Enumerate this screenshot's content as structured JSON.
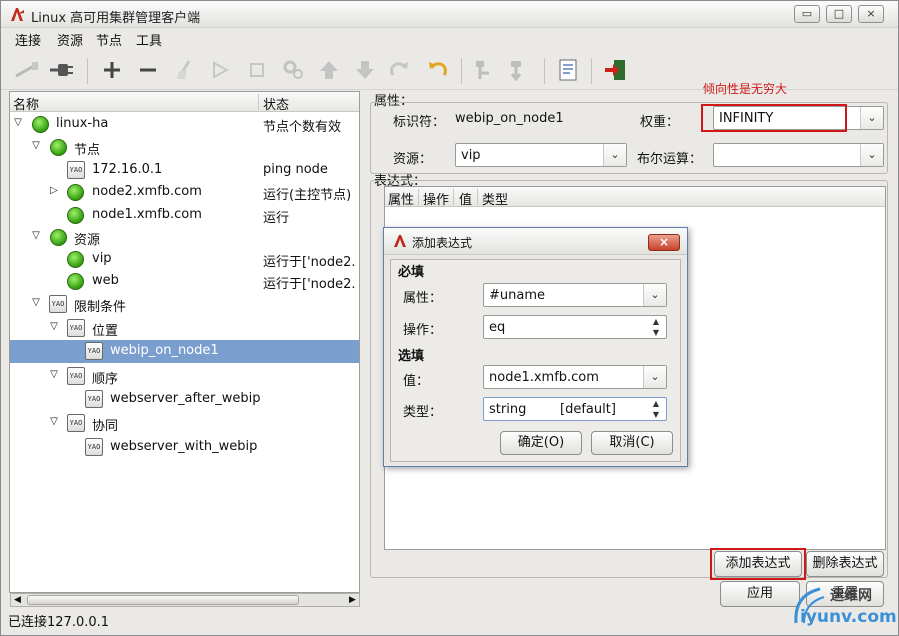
{
  "window": {
    "title": "Linux 高可用集群管理客户端",
    "controls": [
      "▭",
      "□",
      "×"
    ]
  },
  "menu": [
    "连接",
    "资源",
    "节点",
    "工具"
  ],
  "toolbar": [
    "disconnect-icon",
    "connect-icon",
    "add-icon",
    "remove-icon",
    "cleanup-icon",
    "start-icon",
    "stop-icon",
    "settings-icon",
    "move-up-icon",
    "move-down-icon",
    "redo-icon",
    "undo-icon",
    "standby-icon",
    "active-icon",
    "xml-view-icon",
    "exit-icon"
  ],
  "tree": {
    "columns": [
      "名称",
      "状态"
    ],
    "rows": [
      {
        "name": "linux-ha",
        "status": "节点个数有效"
      },
      {
        "name": "节点",
        "status": ""
      },
      {
        "name": "172.16.0.1",
        "status": "ping node"
      },
      {
        "name": "node2.xmfb.com",
        "status": "运行(主控节点)"
      },
      {
        "name": "node1.xmfb.com",
        "status": "运行"
      },
      {
        "name": "资源",
        "status": ""
      },
      {
        "name": "vip",
        "status": "运行于['node2."
      },
      {
        "name": "web",
        "status": "运行于['node2."
      },
      {
        "name": "限制条件",
        "status": ""
      },
      {
        "name": "位置",
        "status": ""
      },
      {
        "name": "webip_on_node1",
        "status": ""
      },
      {
        "name": "顺序",
        "status": ""
      },
      {
        "name": "webserver_after_webip",
        "status": ""
      },
      {
        "name": "协同",
        "status": ""
      },
      {
        "name": "webserver_with_webip",
        "status": ""
      }
    ]
  },
  "status_bar": "已连接127.0.0.1",
  "properties": {
    "section_label": "属性：",
    "id_label": "标识符：",
    "id_value": "webip_on_node1",
    "weight_label": "权重：",
    "weight_value": "INFINITY",
    "annotation": "倾向性是无穷大",
    "resource_label": "资源：",
    "resource_value": "vip",
    "bool_label": "布尔运算：",
    "bool_value": ""
  },
  "expressions": {
    "section_label": "表达式：",
    "columns": [
      "属性",
      "操作",
      "值",
      "类型"
    ],
    "add_button": "添加表达式",
    "delete_button": "删除表达式"
  },
  "footer_buttons": {
    "apply": "应用",
    "reset": "重置"
  },
  "dialog": {
    "title": "添加表达式",
    "required_heading": "必填",
    "attr_label": "属性：",
    "attr_value": "#uname",
    "op_label": "操作：",
    "op_value": "eq",
    "optional_heading": "选填",
    "value_label": "值：",
    "value_value": "node1.xmfb.com",
    "type_label": "类型：",
    "type_value": "string",
    "type_default": "[default]",
    "ok": "确定(O)",
    "cancel": "取消(C)",
    "close": "×"
  },
  "watermark": {
    "text": "运维网",
    "url": "iyunv.com"
  },
  "colors": {
    "selection": "#7a9fcf",
    "annotation_red": "#d01818",
    "status_green": "#39a413"
  }
}
